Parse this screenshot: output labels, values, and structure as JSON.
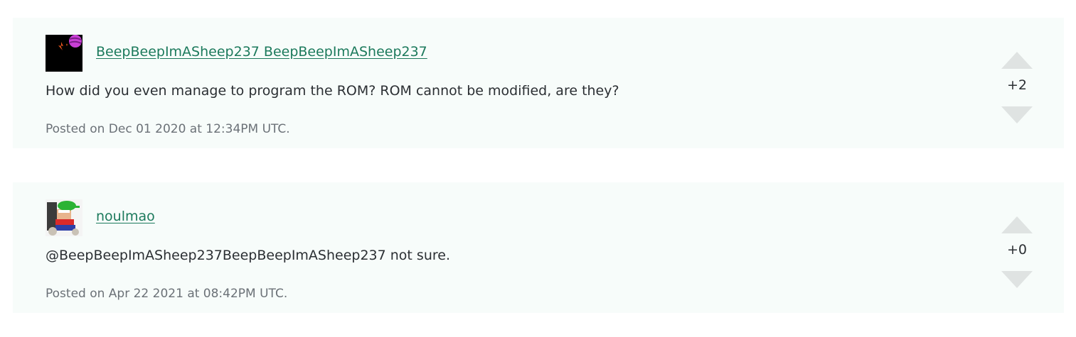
{
  "comments": [
    {
      "username": "BeepBeepImASheep237 BeepBeepImASheep237",
      "text": "How did you even manage to program the ROM? ROM cannot be modified, are they?",
      "posted": "Posted on Dec 01 2020 at 12:34PM UTC.",
      "score": "+2",
      "avatar_icon": "space-planet-avatar"
    },
    {
      "username": "noulmao",
      "text": "@BeepBeepImASheep237BeepBeepImASheep237 not sure.",
      "posted": "Posted on Apr 22 2021 at 08:42PM UTC.",
      "score": "+0",
      "avatar_icon": "cartoon-character-avatar"
    }
  ],
  "colors": {
    "card_background": "#f7fcfa",
    "username_link": "#1c7a5c",
    "vote_arrow": "#dfe3e2"
  }
}
